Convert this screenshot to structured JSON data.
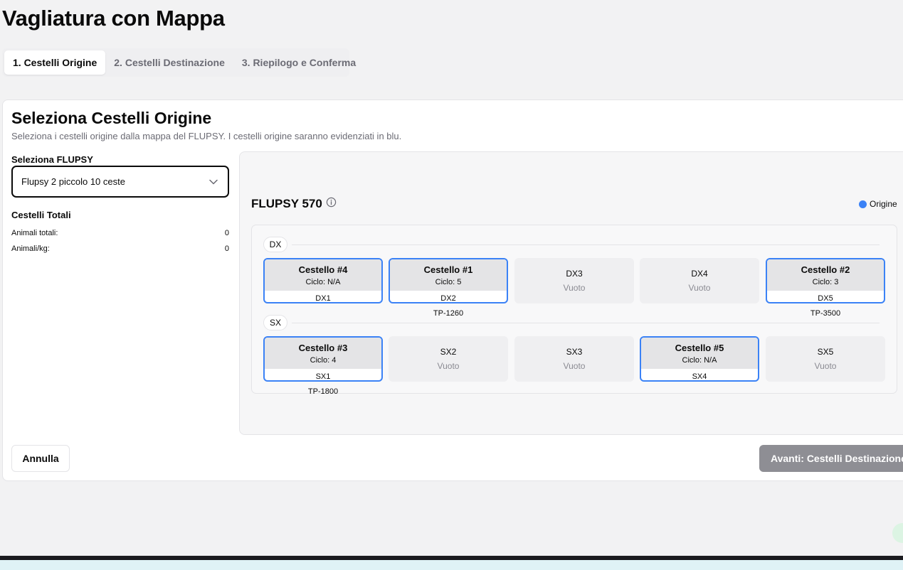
{
  "page": {
    "title": "Vagliatura con Mappa"
  },
  "tabs": [
    {
      "label": "1. Cestelli Origine"
    },
    {
      "label": "2. Cestelli Destinazione"
    },
    {
      "label": "3. Riepilogo e Conferma"
    }
  ],
  "card": {
    "title": "Seleziona Cestelli Origine",
    "subtitle": "Seleziona i cestelli origine dalla mappa del FLUPSY. I cestelli origine saranno evidenziati in blu."
  },
  "left": {
    "select_label": "Seleziona FLUPSY",
    "select_value": "Flupsy 2 piccolo 10 ceste",
    "totals_title": "Cestelli Totali",
    "stats": [
      {
        "label": "Animali totali:",
        "value": "0"
      },
      {
        "label": "Animali/kg:",
        "value": "0"
      }
    ]
  },
  "map": {
    "flupsy_name": "FLUPSY 570",
    "legend_label": "Origine",
    "colors": {
      "origin": "#3b82f6"
    },
    "rows": [
      {
        "label": "DX",
        "baskets": [
          {
            "name": "Cestello #4",
            "cycle": "Ciclo: N/A",
            "position": "DX1",
            "tag": ""
          },
          {
            "name": "Cestello #1",
            "cycle": "Ciclo: 5",
            "position": "DX2",
            "tag": "TP-1260"
          },
          {
            "position": "DX3",
            "status": "Vuoto"
          },
          {
            "position": "DX4",
            "status": "Vuoto"
          },
          {
            "name": "Cestello #2",
            "cycle": "Ciclo: 3",
            "position": "DX5",
            "tag": "TP-3500"
          }
        ]
      },
      {
        "label": "SX",
        "baskets": [
          {
            "name": "Cestello #3",
            "cycle": "Ciclo: 4",
            "position": "SX1",
            "tag": "TP-1800"
          },
          {
            "position": "SX2",
            "status": "Vuoto"
          },
          {
            "position": "SX3",
            "status": "Vuoto"
          },
          {
            "name": "Cestello #5",
            "cycle": "Ciclo: N/A",
            "position": "SX4",
            "tag": ""
          },
          {
            "position": "SX5",
            "status": "Vuoto"
          }
        ]
      }
    ]
  },
  "actions": {
    "cancel_label": "Annulla",
    "next_label": "Avanti: Cestelli Destinazione"
  }
}
